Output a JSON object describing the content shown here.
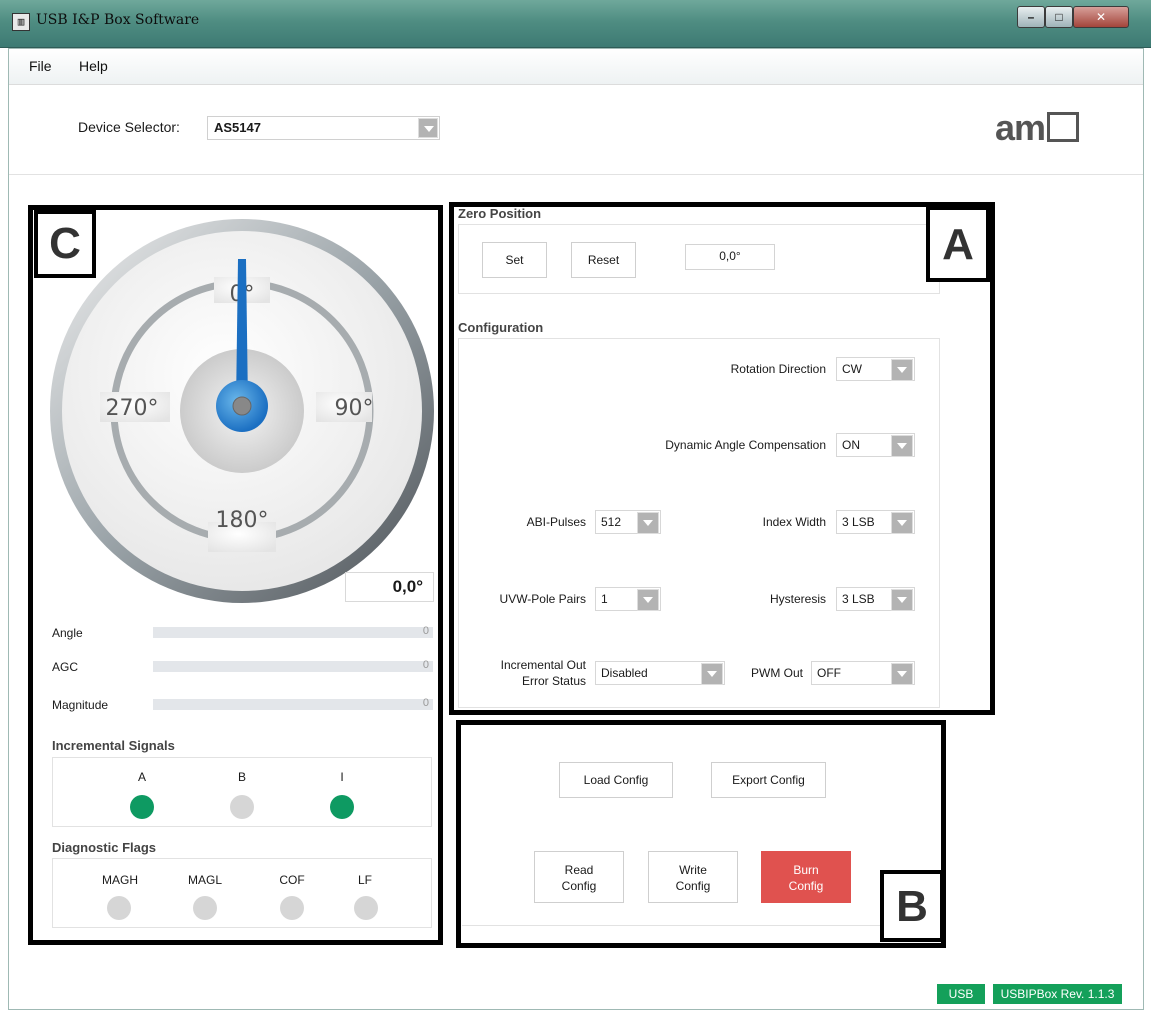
{
  "window": {
    "title": "USB I&P Box Software",
    "minimize": "–",
    "maximize": "□",
    "close": "✕"
  },
  "menu": {
    "file": "File",
    "help": "Help"
  },
  "device": {
    "label": "Device Selector:",
    "value": "AS5147"
  },
  "logo": {
    "text": "am"
  },
  "callouts": {
    "a": "A",
    "b": "B",
    "c": "C"
  },
  "gauge": {
    "label_0": "0°",
    "label_90": "90°",
    "label_180": "180°",
    "label_270": "270°",
    "needle_angle_deg": 0,
    "readout": "0,0°"
  },
  "meters": [
    {
      "label": "Angle",
      "value": "0",
      "fill": 0
    },
    {
      "label": "AGC",
      "value": "0",
      "fill": 0
    },
    {
      "label": "Magnitude",
      "value": "0",
      "fill": 0
    }
  ],
  "incremental": {
    "title": "Incremental Signals",
    "signals": [
      {
        "label": "A",
        "state": "on"
      },
      {
        "label": "B",
        "state": "off"
      },
      {
        "label": "I",
        "state": "on"
      }
    ]
  },
  "diagnostics": {
    "title": "Diagnostic Flags",
    "flags": [
      {
        "label": "MAGH",
        "state": "off"
      },
      {
        "label": "MAGL",
        "state": "off"
      },
      {
        "label": "COF",
        "state": "off"
      },
      {
        "label": "LF",
        "state": "off"
      }
    ]
  },
  "zero": {
    "title": "Zero Position",
    "set": "Set",
    "reset": "Reset",
    "value": "0,0°"
  },
  "config": {
    "title": "Configuration",
    "rotation_direction": {
      "label": "Rotation Direction",
      "value": "CW"
    },
    "dac": {
      "label": "Dynamic Angle Compensation",
      "value": "ON"
    },
    "abi_pulses": {
      "label": "ABI-Pulses",
      "value": "512"
    },
    "index_width": {
      "label": "Index Width",
      "value": "3 LSB"
    },
    "uvw_pole_pairs": {
      "label": "UVW-Pole Pairs",
      "value": "1"
    },
    "hysteresis": {
      "label": "Hysteresis",
      "value": "3 LSB"
    },
    "inc_err": {
      "label_line1": "Incremental Out",
      "label_line2": "Error Status",
      "value": "Disabled"
    },
    "pwm_out": {
      "label": "PWM Out",
      "value": "OFF"
    }
  },
  "actions": {
    "load": "Load Config",
    "export": "Export Config",
    "read_l1": "Read",
    "read_l2": "Config",
    "write_l1": "Write",
    "write_l2": "Config",
    "burn_l1": "Burn",
    "burn_l2": "Config"
  },
  "status": {
    "usb": "USB",
    "rev": "USBIPBox Rev. 1.1.3"
  },
  "colors": {
    "led_on": "#0e9a62",
    "burn": "#e0524f",
    "status": "#14a05a",
    "needle": "#1b6fc2"
  }
}
